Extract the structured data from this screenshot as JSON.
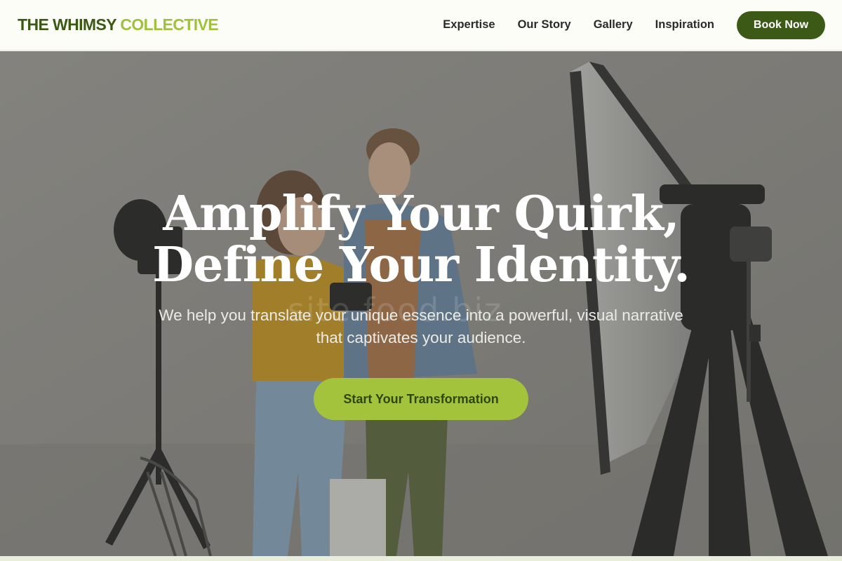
{
  "brand": {
    "part1": "THE WHIMSY",
    "part2": "COLLECTIVE",
    "color_primary": "#3a5a14",
    "color_accent": "#a0c13c"
  },
  "nav": {
    "items": [
      {
        "label": "Expertise"
      },
      {
        "label": "Our Story"
      },
      {
        "label": "Gallery"
      },
      {
        "label": "Inspiration"
      }
    ],
    "cta_label": "Book Now"
  },
  "hero": {
    "headline_line1": "Amplify Your Quirk,",
    "headline_line2": "Define Your Identity.",
    "subtitle_line1": "We help you translate your unique essence into a powerful, visual narrative",
    "subtitle_line2": "that captivates your audience.",
    "cta_label": "Start Your Transformation",
    "watermark_text": "site.food.biz",
    "image_subject": "photo-studio-couple-with-camera"
  },
  "colors": {
    "button_dark": "#3c5a16",
    "button_light": "#a3c33c",
    "overlay": "#464642"
  }
}
